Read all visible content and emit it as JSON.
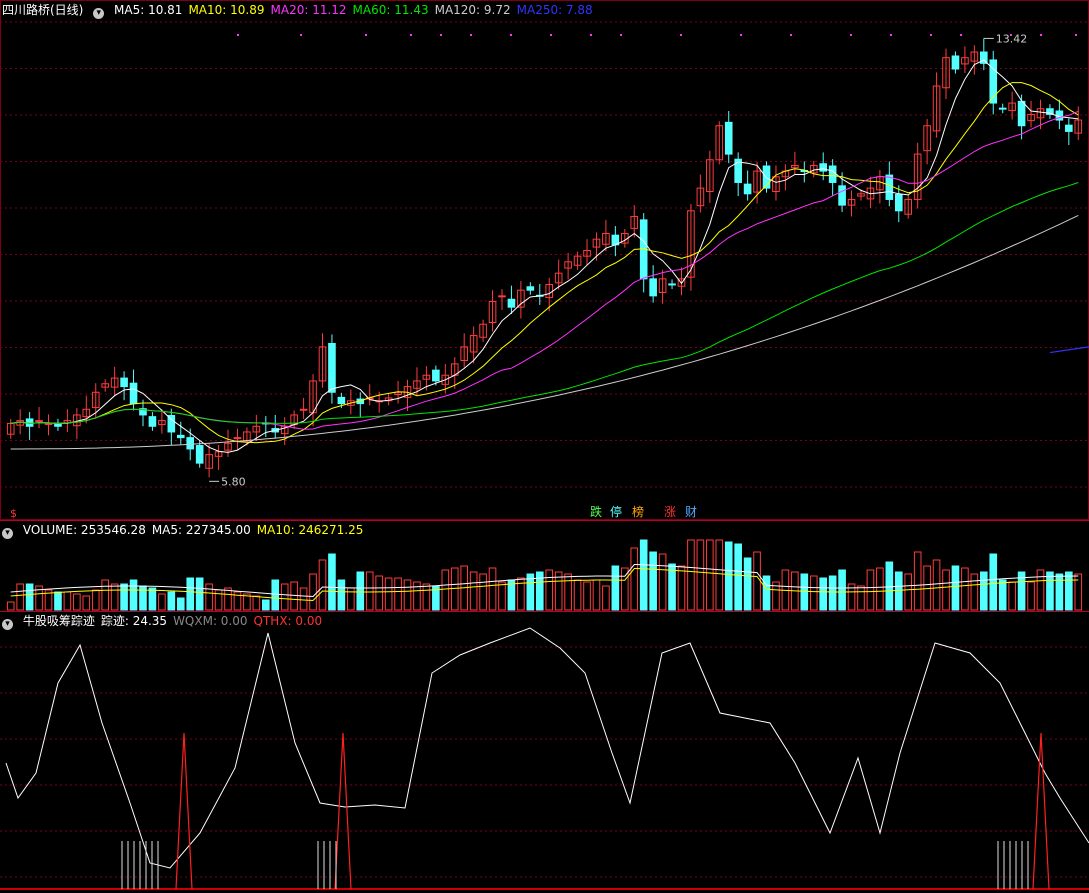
{
  "header": {
    "title": "四川路桥(日线)",
    "ma": [
      {
        "label": "MA5: 10.81",
        "color": "#ffffff"
      },
      {
        "label": "MA10: 10.89",
        "color": "#ffff00"
      },
      {
        "label": "MA20: 11.12",
        "color": "#ff33ff"
      },
      {
        "label": "MA60: 11.43",
        "color": "#00e600"
      },
      {
        "label": "MA120: 9.72",
        "color": "#cccccc"
      },
      {
        "label": "MA250: 7.88",
        "color": "#3333ff"
      }
    ]
  },
  "price_labels": {
    "high": "13.42",
    "low": "5.80"
  },
  "signal_badges": [
    {
      "text": "跌",
      "color": "#55ff55"
    },
    {
      "text": "停",
      "color": "#55ffff"
    },
    {
      "text": "榜",
      "color": "#ffaa00"
    },
    {
      "text": "涨",
      "color": "#ff3333"
    },
    {
      "text": "财",
      "color": "#55aaff"
    }
  ],
  "s_marker": "$",
  "volume_header": {
    "items": [
      {
        "label": "VOLUME: 253546.28",
        "color": "#ffffff"
      },
      {
        "label": "MA5: 227345.00",
        "color": "#ffffff"
      },
      {
        "label": "MA10: 246271.25",
        "color": "#ffff00"
      }
    ]
  },
  "indicator_header": {
    "items": [
      {
        "label": "牛股吸筹踪迹",
        "color": "#ffffff"
      },
      {
        "label": "踪迹: 24.35",
        "color": "#ffffff"
      },
      {
        "label": "WQXM: 0.00",
        "color": "#888888"
      },
      {
        "label": "QTHX: 0.00",
        "color": "#ff3333"
      }
    ]
  },
  "chart_data": {
    "type": "candlestick",
    "price_range": [
      5.2,
      13.7
    ],
    "closes": [
      6.55,
      6.6,
      6.5,
      6.6,
      6.55,
      6.5,
      6.6,
      6.7,
      6.8,
      7.1,
      7.25,
      7.35,
      7.2,
      6.9,
      6.7,
      6.5,
      6.6,
      6.4,
      6.3,
      6.1,
      5.85,
      6.0,
      6.05,
      6.2,
      6.3,
      6.4,
      6.5,
      6.55,
      6.4,
      6.5,
      6.7,
      6.8,
      7.3,
      7.9,
      7.1,
      6.9,
      6.95,
      6.9,
      7.0,
      6.95,
      7.0,
      7.1,
      7.2,
      7.3,
      7.4,
      7.3,
      7.4,
      7.6,
      7.9,
      8.1,
      8.3,
      8.7,
      8.8,
      8.6,
      8.9,
      8.9,
      8.8,
      9.0,
      9.2,
      9.4,
      9.5,
      9.6,
      9.8,
      9.9,
      9.7,
      9.9,
      10.2,
      9.1,
      8.8,
      9.1,
      9.0,
      9.1,
      10.3,
      10.7,
      11.2,
      11.8,
      11.3,
      10.8,
      10.6,
      11.0,
      10.7,
      10.9,
      11.0,
      11.1,
      11.0,
      11.1,
      11.0,
      10.8,
      10.4,
      10.5,
      10.6,
      10.7,
      10.9,
      10.5,
      10.3,
      10.5,
      11.3,
      11.8,
      12.5,
      13.0,
      12.8,
      13.0,
      13.1,
      12.9,
      12.2,
      12.1,
      12.2,
      11.8,
      12.0,
      12.1,
      12.0,
      11.9,
      11.7,
      11.9
    ],
    "ma_series": [
      "MA5",
      "MA10",
      "MA20",
      "MA60",
      "MA120",
      "MA250"
    ],
    "volume": {
      "ma5": 227345.0,
      "ma10": 246271.25,
      "last": 253546.28
    },
    "indicator": {
      "name": "牛股吸筹踪迹",
      "value": 24.35,
      "WQXM": 0.0,
      "QTHX": 0.0
    }
  }
}
